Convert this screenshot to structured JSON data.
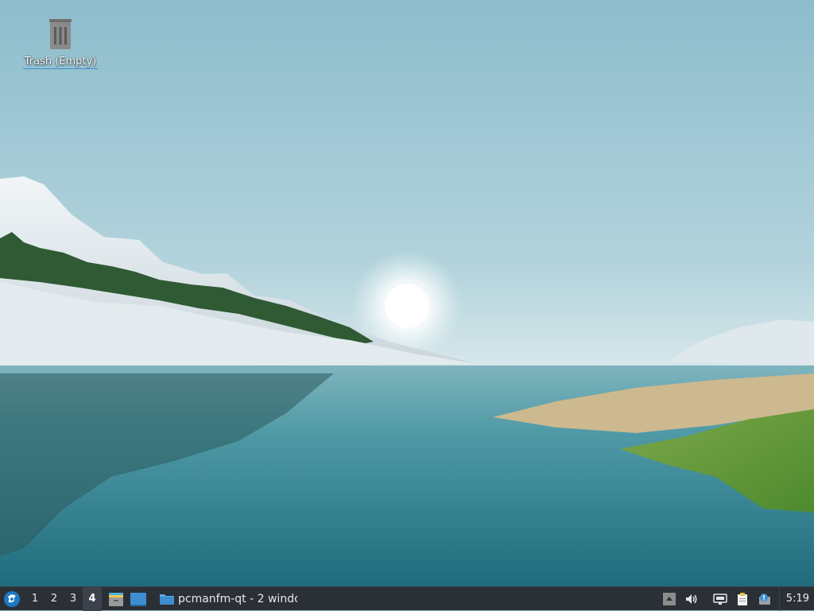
{
  "desktop": {
    "trash": {
      "label": "Trash (Empty)",
      "icon": "trash-icon"
    }
  },
  "panel": {
    "menu_icon": "lxqt-menu-icon",
    "desktops": [
      "1",
      "2",
      "3",
      "4"
    ],
    "active_desktop": "4",
    "quicklaunch": [
      {
        "name": "file-manager-launcher",
        "icon": "file-manager-icon"
      },
      {
        "name": "show-desktop-launcher",
        "icon": "show-desktop-icon"
      }
    ],
    "task": {
      "label": "pcmanfm-qt - 2 windo...",
      "icon": "folder-icon"
    },
    "tray": [
      {
        "name": "tray-up-arrow",
        "icon": "arrow-up-icon"
      },
      {
        "name": "volume",
        "icon": "volume-icon"
      },
      {
        "name": "network",
        "icon": "network-icon"
      },
      {
        "name": "clipboard",
        "icon": "clipboard-icon"
      },
      {
        "name": "update-notifier",
        "icon": "update-notifier-icon"
      }
    ],
    "clock": "5:19"
  },
  "colors": {
    "panel_bg": "#2b2f36",
    "active_desktop_bg": "#3c424c",
    "accent": "#3d8fd1"
  }
}
